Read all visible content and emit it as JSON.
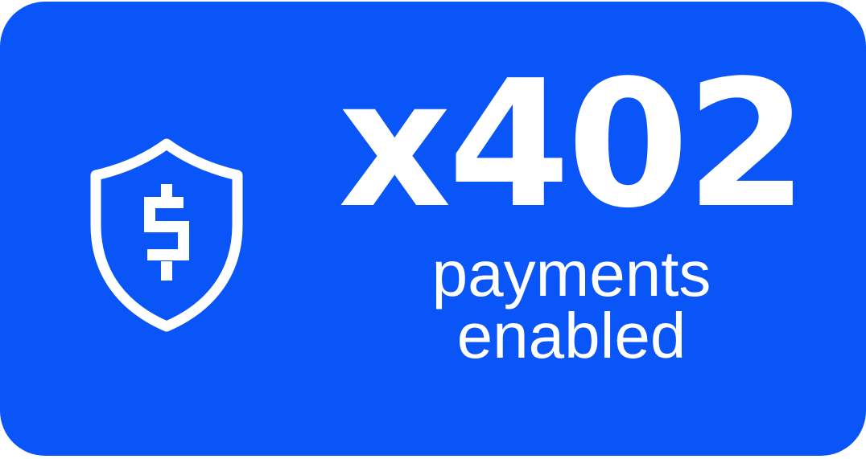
{
  "badge": {
    "multiplier": "x402",
    "caption_line1": "payments",
    "caption_line2": "enabled",
    "icon": "shield-dollar-icon",
    "background_color": "#0a55f8",
    "text_color": "#ffffff"
  }
}
